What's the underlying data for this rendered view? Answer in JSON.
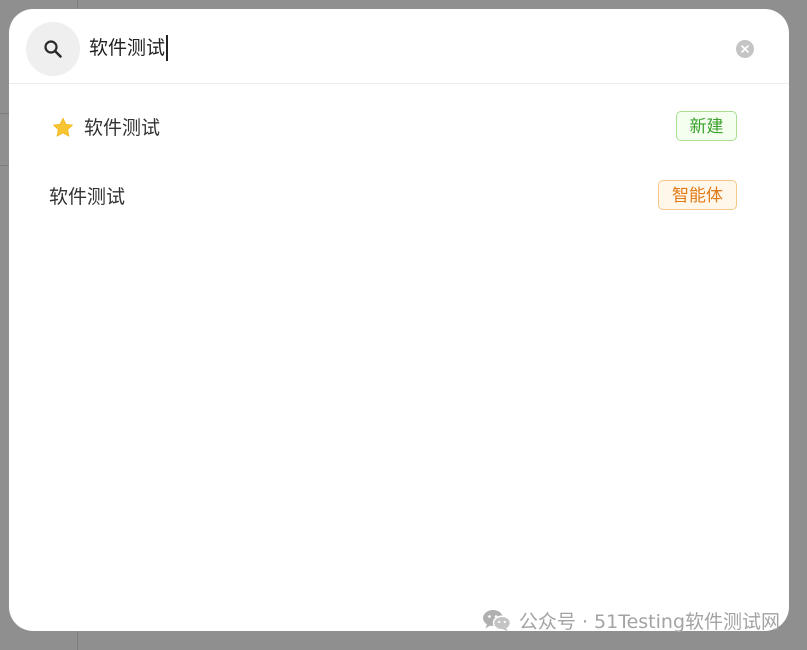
{
  "search": {
    "query": "软件测试"
  },
  "results": [
    {
      "label": "软件测试",
      "badge": "新建",
      "icon": "star-icon"
    },
    {
      "label": "软件测试",
      "badge": "智能体"
    }
  ],
  "watermark": {
    "text": "公众号 · 51Testing软件测试网",
    "icon": "wechat-icon"
  },
  "colors": {
    "badge_new_text": "#3aa12c",
    "badge_new_border": "#a8e08f",
    "badge_agent_text": "#e07a17",
    "badge_agent_border": "#f6c68a",
    "star": "#f7c531"
  }
}
